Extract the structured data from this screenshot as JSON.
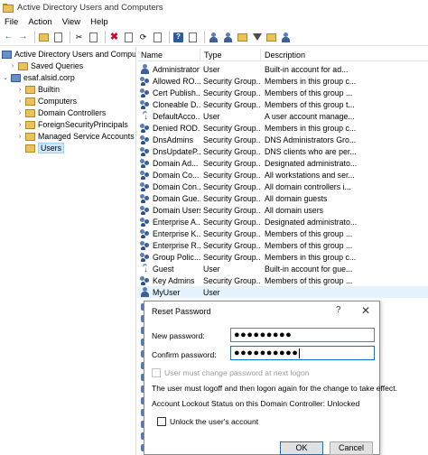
{
  "window": {
    "title": "Active Directory Users and Computers"
  },
  "menu": [
    "File",
    "Action",
    "View",
    "Help"
  ],
  "toolbar": {
    "buttons": [
      "back-arrow-icon",
      "forward-arrow-icon",
      "up-folder-icon",
      "show-hide-tree-icon",
      "cut-icon",
      "copy-icon",
      "delete-icon",
      "properties-icon",
      "refresh-icon",
      "export-list-icon",
      "help-icon",
      "mmc-icon",
      "new-user-icon",
      "new-group-icon",
      "new-ou-icon",
      "filter-icon",
      "find-icon",
      "add-to-group-icon"
    ]
  },
  "tree": {
    "root": "Active Directory Users and Compute",
    "items": [
      {
        "label": "Saved Queries",
        "level": 1,
        "expander": "›",
        "icon": "folder"
      },
      {
        "label": "esaf.alsid.corp",
        "level": 1,
        "expander": "⌄",
        "icon": "domain"
      },
      {
        "label": "Builtin",
        "level": 2,
        "expander": "›",
        "icon": "folder"
      },
      {
        "label": "Computers",
        "level": 2,
        "expander": "›",
        "icon": "folder"
      },
      {
        "label": "Domain Controllers",
        "level": 2,
        "expander": "›",
        "icon": "folder"
      },
      {
        "label": "ForeignSecurityPrincipals",
        "level": 2,
        "expander": "›",
        "icon": "folder"
      },
      {
        "label": "Managed Service Accounts",
        "level": 2,
        "expander": "›",
        "icon": "folder"
      },
      {
        "label": "Users",
        "level": 2,
        "expander": "",
        "icon": "folder",
        "selected": true
      }
    ]
  },
  "list": {
    "columns": [
      "Name",
      "Type",
      "Description"
    ],
    "rows": [
      {
        "name": "Administrator",
        "type": "User",
        "desc": "Built-in account for ad...",
        "icon": "user"
      },
      {
        "name": "Allowed RO...",
        "type": "Security Group...",
        "desc": "Members in this group c...",
        "icon": "group"
      },
      {
        "name": "Cert Publish...",
        "type": "Security Group...",
        "desc": "Members of this group ...",
        "icon": "group"
      },
      {
        "name": "Cloneable D...",
        "type": "Security Group...",
        "desc": "Members of this group t...",
        "icon": "group"
      },
      {
        "name": "DefaultAcco...",
        "type": "User",
        "desc": "A user account manage...",
        "icon": "disabled-user"
      },
      {
        "name": "Denied ROD...",
        "type": "Security Group...",
        "desc": "Members in this group c...",
        "icon": "group"
      },
      {
        "name": "DnsAdmins",
        "type": "Security Group...",
        "desc": "DNS Administrators Gro...",
        "icon": "group"
      },
      {
        "name": "DnsUpdateP...",
        "type": "Security Group...",
        "desc": "DNS clients who are per...",
        "icon": "group"
      },
      {
        "name": "Domain Ad...",
        "type": "Security Group...",
        "desc": "Designated administrato...",
        "icon": "group"
      },
      {
        "name": "Domain Co...",
        "type": "Security Group...",
        "desc": "All workstations and ser...",
        "icon": "group"
      },
      {
        "name": "Domain Con...",
        "type": "Security Group...",
        "desc": "All domain controllers i...",
        "icon": "group"
      },
      {
        "name": "Domain Gue...",
        "type": "Security Group...",
        "desc": "All domain guests",
        "icon": "group"
      },
      {
        "name": "Domain Users",
        "type": "Security Group...",
        "desc": "All domain users",
        "icon": "group"
      },
      {
        "name": "Enterprise A...",
        "type": "Security Group...",
        "desc": "Designated administrato...",
        "icon": "group"
      },
      {
        "name": "Enterprise K...",
        "type": "Security Group...",
        "desc": "Members of this group ...",
        "icon": "group"
      },
      {
        "name": "Enterprise R...",
        "type": "Security Group...",
        "desc": "Members of this group ...",
        "icon": "group"
      },
      {
        "name": "Group Polic...",
        "type": "Security Group...",
        "desc": "Members in this group c...",
        "icon": "group"
      },
      {
        "name": "Guest",
        "type": "User",
        "desc": "Built-in account for gue...",
        "icon": "disabled-user"
      },
      {
        "name": "Key Admins",
        "type": "Security Group...",
        "desc": "Members of this group ...",
        "icon": "group"
      },
      {
        "name": "MyUser",
        "type": "User",
        "desc": "",
        "icon": "user",
        "selected": true
      }
    ]
  },
  "dialog": {
    "title": "Reset Password",
    "help_glyph": "?",
    "close_glyph": "✕",
    "new_password_label": "New password:",
    "new_password_value": "●●●●●●●●●",
    "confirm_password_label": "Confirm password:",
    "confirm_password_value": "●●●●●●●●●●",
    "must_change_label": "User must change password at next logon",
    "logoff_note": "The user must logoff and then logon again for the change to take effect.",
    "lockout_status": "Account Lockout Status on this Domain Controller: Unlocked",
    "unlock_label": "Unlock the user's account",
    "ok_label": "OK",
    "cancel_label": "Cancel"
  }
}
